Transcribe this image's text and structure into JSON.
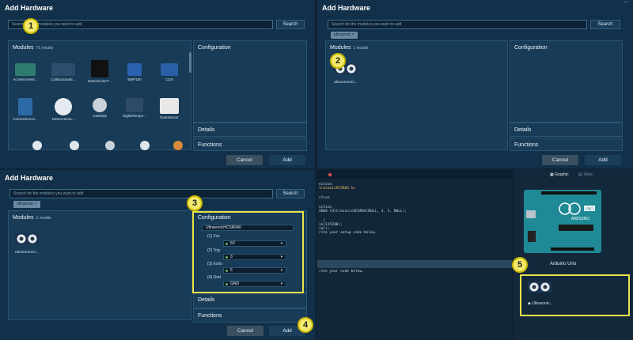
{
  "colors": {
    "accent": "#f3e96a",
    "panel": "#123049",
    "page": "#0f2436"
  },
  "p1": {
    "title": "Add Hardware",
    "search_placeholder": "Search for the modules you want to add",
    "search_btn": "Search",
    "modules_label": "Modules",
    "modules_count": "71 results",
    "config_label": "Configuration",
    "details_label": "Details",
    "functions_label": "Functions",
    "cancel": "Cancel",
    "add": "Add",
    "items": [
      {
        "label": "Acceleromete..."
      },
      {
        "label": "CollisionSwitc..."
      },
      {
        "label": "DetectColorT..."
      },
      {
        "label": "BMP180"
      },
      {
        "label": "CDS"
      },
      {
        "label": "CurrentSenso..."
      },
      {
        "label": "DetectHuma..."
      },
      {
        "label": "GasMQ5"
      },
      {
        "label": "DigitalTempe..."
      },
      {
        "label": "DustSensor"
      }
    ]
  },
  "p2": {
    "title": "Add Hardware",
    "search_placeholder": "Search for the modules you want to add",
    "search_btn": "Search",
    "chip": "ultrasonic",
    "modules_label": "Modules",
    "modules_count": "1 results",
    "item_label": "UltrasonicHC...",
    "config_label": "Configuration",
    "details_label": "Details",
    "functions_label": "Functions",
    "cancel": "Cancel",
    "add": "Add"
  },
  "p3": {
    "title": "Add Hardware",
    "search_placeholder": "Search for the modules you want to add",
    "search_btn": "Search",
    "chip": "ultrasonic",
    "modules_label": "Modules",
    "modules_count": "1 results",
    "item_label": "UltrasonicHC...",
    "config_label": "Configuration",
    "config_name": "UltrasonicHCSR040",
    "pins": [
      {
        "label": "(1) Vcc",
        "value": "5V"
      },
      {
        "label": "(2) Trig",
        "value": "3"
      },
      {
        "label": "(3) Echo",
        "value": "5"
      },
      {
        "label": "(4) Gnd",
        "value": "GND"
      }
    ],
    "details_label": "Details",
    "functions_label": "Functions",
    "cancel": "Cancel",
    "add": "Add"
  },
  "p4": {
    "tab_graphic": "Graphic",
    "tab_table": "Table",
    "code_lines": [
      "ection",
      "trasonicHCSR04.h>",
      "",
      "ction",
      "",
      "ection",
      "SR04 (UltrasonicHCSR04(NULL, 3, 5, NULL);",
      "",
      "  {",
      "in(115200);",
      "ial);",
      "rite your setup code below.",
      "",
      "",
      "",
      "",
      "rite your code below.",
      ""
    ],
    "board_name": "Arduino Uno",
    "module_label": "Ultrasonic..."
  },
  "steps": [
    "1",
    "2",
    "3",
    "4",
    "5"
  ]
}
